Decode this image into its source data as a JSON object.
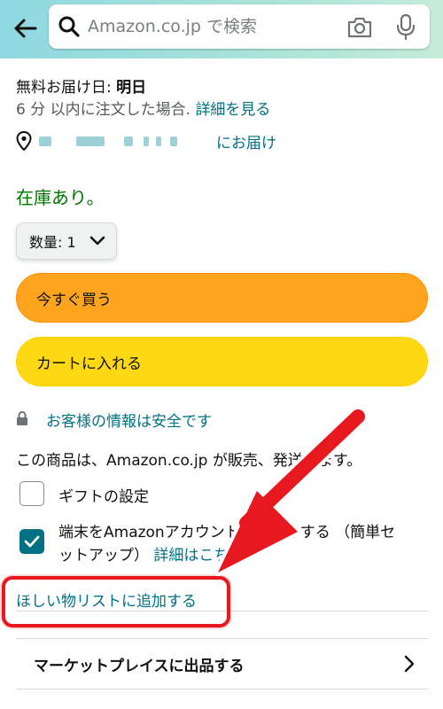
{
  "header": {
    "search_placeholder": "Amazon.co.jp で検索",
    "icons": [
      "back-arrow-icon",
      "search-icon",
      "camera-icon",
      "mic-icon"
    ]
  },
  "delivery": {
    "label": "無料お届け日: ",
    "date": "明日",
    "order_within": "6 分 以内に注文した場合.",
    "details_link": "詳細を見る",
    "deliver_to": "にお届け"
  },
  "stock": "在庫あり。",
  "quantity": {
    "label": "数量: 1"
  },
  "buttons": {
    "buy_now": "今すぐ買う",
    "add_to_cart": "カートに入れる"
  },
  "secure": "お客様の情報は安全です",
  "seller": "この商品は、Amazon.co.jp が販売、発送します。",
  "options": {
    "gift": {
      "label": "ギフトの設定",
      "checked": false
    },
    "link_device": {
      "label": "端末をAmazonアカウントにリンクする （簡単セットアップ）",
      "details_link": "詳細はこちら",
      "checked": true
    }
  },
  "wishlist": "ほしい物リストに追加する",
  "marketplace": "マーケットプレイスに出品する",
  "colors": {
    "header_gradient_start": "#8fd8e0",
    "header_gradient_end": "#c5ecd9",
    "buy_now": "#ffa41c",
    "add_to_cart": "#ffd814",
    "link": "#007185",
    "in_stock": "#007600",
    "annotation_red": "#e8191e"
  }
}
